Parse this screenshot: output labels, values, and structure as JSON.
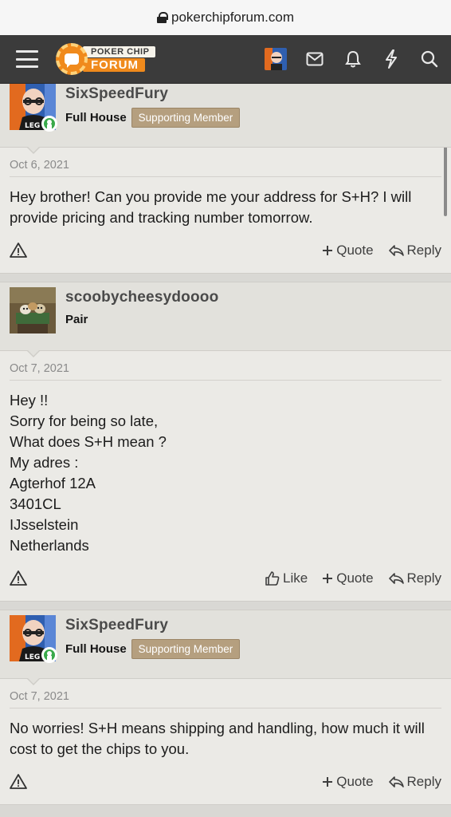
{
  "browser": {
    "url": "pokerchipforum.com"
  },
  "header": {
    "logo_line1": "POKER CHIP",
    "logo_line2": "FORUM"
  },
  "posts": [
    {
      "username": "SixSpeedFury",
      "rank": "Full House",
      "badge": "Supporting Member",
      "avatar": "bald-man-glasses-avatar",
      "online": true,
      "date": "Oct 6, 2021",
      "content": "Hey brother! Can you provide me your address for S+H? I will provide pricing and tracking number tomorrow.",
      "actions": {
        "quote": "Quote",
        "reply": "Reply"
      }
    },
    {
      "username": "scoobycheesydoooo",
      "rank": "Pair",
      "avatar": "dogs-playing-poker-avatar",
      "online": false,
      "date": "Oct 7, 2021",
      "content": "Hey !!\nSorry for being so late,\nWhat does S+H mean ?\nMy adres :\nAgterhof 12A\n3401CL\nIJsselstein\nNetherlands",
      "actions": {
        "like": "Like",
        "quote": "Quote",
        "reply": "Reply"
      }
    },
    {
      "username": "SixSpeedFury",
      "rank": "Full House",
      "badge": "Supporting Member",
      "avatar": "bald-man-glasses-avatar",
      "online": true,
      "date": "Oct 7, 2021",
      "content": "No worries! S+H means shipping and handling, how much it will cost to get the chips to you.",
      "actions": {
        "quote": "Quote",
        "reply": "Reply"
      }
    }
  ],
  "colors": {
    "navbar": "#3b3b3b",
    "accent": "#f08a1c",
    "badge": "#b59f7f",
    "online": "#39a94a"
  }
}
